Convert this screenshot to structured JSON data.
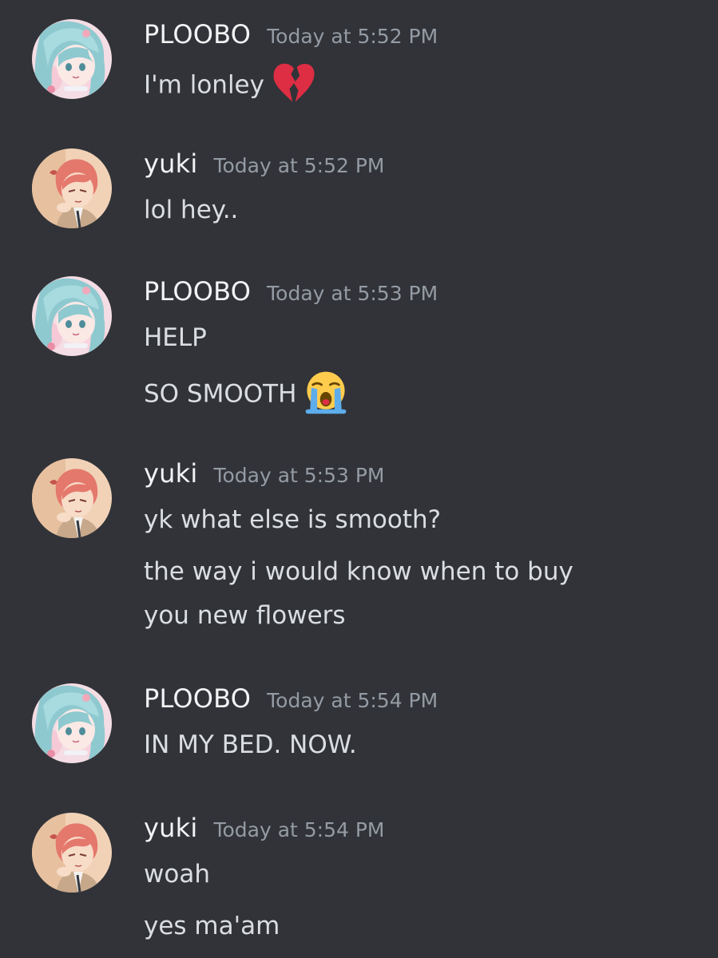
{
  "colors": {
    "background": "#313338",
    "username": "#f2f3f5",
    "timestamp": "#949ba4",
    "message_text": "#dbdee1"
  },
  "messages": [
    {
      "author": "PLOOBO",
      "timestamp": "Today at 5:52 PM",
      "avatar": "ploobo-avatar",
      "lines": [
        {
          "text": "I'm lonley",
          "emoji": "broken-heart-icon"
        }
      ]
    },
    {
      "author": "yuki",
      "timestamp": "Today at 5:52 PM",
      "avatar": "yuki-avatar",
      "lines": [
        {
          "text": "lol hey.."
        }
      ]
    },
    {
      "author": "PLOOBO",
      "timestamp": "Today at 5:53 PM",
      "avatar": "ploobo-avatar",
      "lines": [
        {
          "text": "HELP"
        },
        {
          "text": "SO SMOOTH",
          "emoji": "loudly-crying-face-icon"
        }
      ]
    },
    {
      "author": "yuki",
      "timestamp": "Today at 5:53 PM",
      "avatar": "yuki-avatar",
      "lines": [
        {
          "text": "yk what else is smooth?"
        },
        {
          "text": "the way i would know when to buy"
        },
        {
          "text": "you new flowers"
        }
      ]
    },
    {
      "author": "PLOOBO",
      "timestamp": "Today at 5:54 PM",
      "avatar": "ploobo-avatar",
      "lines": [
        {
          "text": "IN MY BED. NOW."
        }
      ]
    },
    {
      "author": "yuki",
      "timestamp": "Today at 5:54 PM",
      "avatar": "yuki-avatar",
      "lines": [
        {
          "text": "woah"
        },
        {
          "text": "yes ma'am"
        }
      ]
    }
  ]
}
